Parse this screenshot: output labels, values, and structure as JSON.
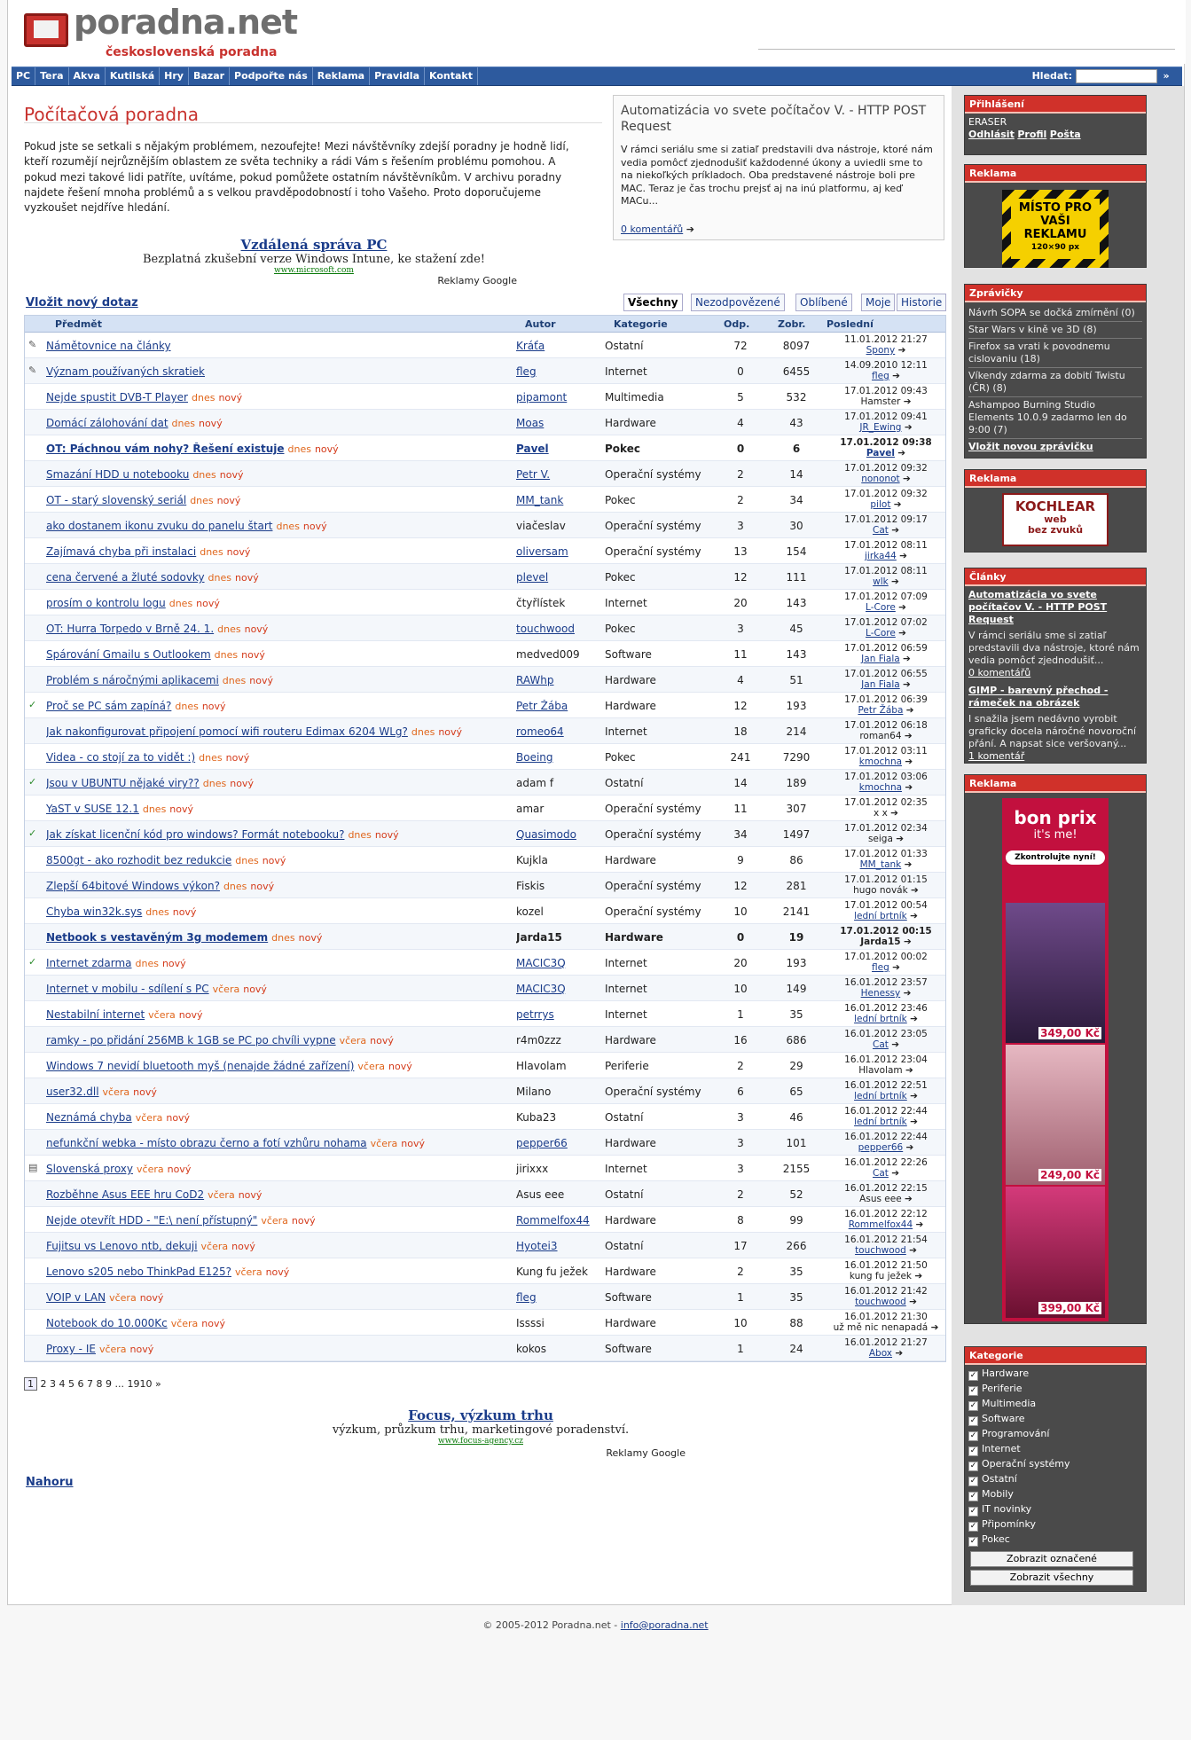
{
  "site": {
    "name": "poradna.net",
    "tagline": "československá poradna"
  },
  "nav": [
    "PC",
    "Tera",
    "Akva",
    "Kutilská",
    "Hry",
    "Bazar",
    "Podpořte nás",
    "Reklama",
    "Pravidla",
    "Kontakt"
  ],
  "search": {
    "label": "Hledat:",
    "go": "»"
  },
  "intro": {
    "title": "Počítačová poradna",
    "text": "Pokud jste se setkali s nějakým problémem, nezoufejte! Mezi návštěvníky zdejší poradny je hodně lidí, kteří rozumějí nejrůznějším oblastem ze světa techniky a rádi Vám s řešením problému pomohou. A pokud mezi takové lidi patříte, uvítáme, pokud pomůžete ostatním návštěvníkům. V archivu poradny najdete řešení mnoha problémů a s velkou pravděpodobností i toho Vašeho. Proto doporučujeme vyzkoušet nejdříve hledání."
  },
  "article": {
    "title": "Automatizácia vo svete počítačov V. - HTTP POST Request",
    "text": "V rámci seriálu sme si zatiaľ predstavili dva nástroje, ktoré nám vedia pomôcť zjednodušiť každodenné úkony a uviedli sme to na niekoľkých príkladoch. Oba predstavené nástroje boli pre MAC. Teraz je čas trochu prejsť aj na inú platformu, aj keď MACu...",
    "comments": "0 komentářů"
  },
  "ad1": {
    "title": "Vzdálená správa PC",
    "desc": "Bezplatná zkušební verze Windows Intune, ke stažení zde!",
    "url": "www.microsoft.com",
    "by": "Reklamy Google"
  },
  "ad2": {
    "title": "Focus, výzkum trhu",
    "desc": "výzkum, průzkum trhu, marketingové poradenství.",
    "url": "www.focus-agency.cz",
    "by": "Reklamy Google"
  },
  "question_bar": {
    "new": "Vložit nový dotaz",
    "tabs": [
      "Všechny",
      "Nezodpovězené",
      "Oblíbené",
      "Moje",
      "Historie"
    ]
  },
  "table_header": {
    "subject": "Předmět",
    "author": "Autor",
    "category": "Kategorie",
    "replies": "Odp.",
    "views": "Zobr.",
    "last": "Poslední"
  },
  "labels": {
    "today": "dnes",
    "yesterday": "včera",
    "new": "nový"
  },
  "rows": [
    {
      "icon": "pin",
      "s": "Námětovnice na články",
      "a": "Kráťa",
      "al": 1,
      "k": "Ostatní",
      "o": "72",
      "z": "8097",
      "d1": "11.01.2012 21:27",
      "d2": "Spony",
      "l": 1
    },
    {
      "icon": "pin",
      "s": "Význam používaných skratiek",
      "a": "fleg",
      "al": 1,
      "k": "Internet",
      "o": "0",
      "z": "6455",
      "d1": "14.09.2010 12:11",
      "d2": "fleg",
      "l": 1
    },
    {
      "s": "Nejde spustit DVB-T Player",
      "tag": "dnes",
      "a": "pipamont",
      "al": 1,
      "k": "Multimedia",
      "o": "5",
      "z": "532",
      "d1": "17.01.2012 09:43",
      "d2": "Hamster"
    },
    {
      "s": "Domácí zálohování dat",
      "tag": "dnes",
      "a": "Moas",
      "al": 1,
      "k": "Hardware",
      "o": "4",
      "z": "43",
      "d1": "17.01.2012 09:41",
      "d2": "JR_Ewing",
      "l": 1
    },
    {
      "s": "OT: Páchnou vám nohy? Řešení existuje",
      "tag": "dnes",
      "a": "Pavel",
      "al": 1,
      "k": "Pokec",
      "o": "0",
      "z": "6",
      "d1": "17.01.2012 09:38",
      "d2": "Pavel",
      "l": 1,
      "bold": 1
    },
    {
      "s": "Smazání HDD u notebooku",
      "tag": "dnes",
      "a": "Petr V.",
      "al": 1,
      "k": "Operační systémy",
      "o": "2",
      "z": "14",
      "d1": "17.01.2012 09:32",
      "d2": "nononot",
      "l": 1
    },
    {
      "s": "OT - starý slovenský seriál",
      "tag": "dnes",
      "a": "MM_tank",
      "al": 1,
      "k": "Pokec",
      "o": "2",
      "z": "34",
      "d1": "17.01.2012 09:32",
      "d2": "pilot",
      "l": 1
    },
    {
      "s": "ako dostanem ikonu zvuku do panelu štart",
      "tag": "dnes",
      "a": "viačeslav",
      "k": "Operační systémy",
      "o": "3",
      "z": "30",
      "d1": "17.01.2012 09:17",
      "d2": "Cat",
      "l": 1
    },
    {
      "s": "Zajímavá chyba při instalaci",
      "tag": "dnes",
      "a": "oliversam",
      "al": 1,
      "k": "Operační systémy",
      "o": "13",
      "z": "154",
      "d1": "17.01.2012 08:11",
      "d2": "jirka44",
      "l": 1
    },
    {
      "s": "cena červené a žluté sodovky",
      "tag": "dnes",
      "a": "plevel",
      "al": 1,
      "k": "Pokec",
      "o": "12",
      "z": "111",
      "d1": "17.01.2012 08:11",
      "d2": "wlk",
      "l": 1
    },
    {
      "s": "prosím o kontrolu logu",
      "tag": "dnes",
      "a": "čtyřlístek",
      "k": "Internet",
      "o": "20",
      "z": "143",
      "d1": "17.01.2012 07:09",
      "d2": "L-Core",
      "l": 1
    },
    {
      "s": "OT: Hurra Torpedo v Brně 24. 1.",
      "tag": "dnes",
      "a": "touchwood",
      "al": 1,
      "k": "Pokec",
      "o": "3",
      "z": "45",
      "d1": "17.01.2012 07:02",
      "d2": "L-Core",
      "l": 1
    },
    {
      "s": "Spárování Gmailu s Outlookem",
      "tag": "dnes",
      "a": "medved009",
      "k": "Software",
      "o": "11",
      "z": "143",
      "d1": "17.01.2012 06:59",
      "d2": "Jan Fiala",
      "l": 1
    },
    {
      "s": "Problém s náročnými aplikacemi",
      "tag": "dnes",
      "a": "RAWhp",
      "al": 1,
      "k": "Hardware",
      "o": "4",
      "z": "51",
      "d1": "17.01.2012 06:55",
      "d2": "Jan Fiala",
      "l": 1
    },
    {
      "icon": "check",
      "s": "Proč se PC sám zapíná?",
      "tag": "dnes",
      "a": "Petr Žába",
      "al": 1,
      "k": "Hardware",
      "o": "12",
      "z": "193",
      "d1": "17.01.2012 06:39",
      "d2": "Petr Žába",
      "l": 1
    },
    {
      "s": "Jak nakonfigurovat připojení pomocí wifi routeru Edimax 6204 WLg?",
      "tag": "dnes",
      "a": "romeo64",
      "al": 1,
      "k": "Internet",
      "o": "18",
      "z": "214",
      "d1": "17.01.2012 06:18",
      "d2": "roman64"
    },
    {
      "s": "Videa - co stojí za to vidět :)",
      "tag": "dnes",
      "a": "Boeing",
      "al": 1,
      "k": "Pokec",
      "o": "241",
      "z": "7290",
      "d1": "17.01.2012 03:11",
      "d2": "kmochna",
      "l": 1
    },
    {
      "icon": "check",
      "s": "Jsou v UBUNTU nějaké viry??",
      "tag": "dnes",
      "a": "adam f",
      "k": "Ostatní",
      "o": "14",
      "z": "189",
      "d1": "17.01.2012 03:06",
      "d2": "kmochna",
      "l": 1
    },
    {
      "s": "YaST v SUSE 12.1",
      "tag": "dnes",
      "a": "amar",
      "k": "Operační systémy",
      "o": "11",
      "z": "307",
      "d1": "17.01.2012 02:35",
      "d2": "x x"
    },
    {
      "icon": "check",
      "s": "Jak získat licenční kód pro windows? Formát notebooku?",
      "tag": "dnes",
      "a": "Quasimodo",
      "al": 1,
      "k": "Operační systémy",
      "o": "34",
      "z": "1497",
      "d1": "17.01.2012 02:34",
      "d2": "seiga"
    },
    {
      "s": "8500gt - ako rozhodit bez redukcie",
      "tag": "dnes",
      "a": "Kujkla",
      "k": "Hardware",
      "o": "9",
      "z": "86",
      "d1": "17.01.2012 01:33",
      "d2": "MM_tank",
      "l": 1
    },
    {
      "s": "Zlepší 64bitové Windows výkon?",
      "tag": "dnes",
      "a": "Fiskis",
      "k": "Operační systémy",
      "o": "12",
      "z": "281",
      "d1": "17.01.2012 01:15",
      "d2": "hugo novák"
    },
    {
      "s": "Chyba win32k.sys",
      "tag": "dnes",
      "a": "kozel",
      "k": "Operační systémy",
      "o": "10",
      "z": "2141",
      "d1": "17.01.2012 00:54",
      "d2": "lední brtník",
      "l": 1
    },
    {
      "s": "Netbook s vestavěným 3g modemem",
      "tag": "dnes",
      "a": "Jarda15",
      "k": "Hardware",
      "o": "0",
      "z": "19",
      "d1": "17.01.2012 00:15",
      "d2": "Jarda15",
      "bold": 1
    },
    {
      "icon": "check",
      "s": "Internet zdarma",
      "tag": "dnes",
      "a": "MACIC3Q",
      "al": 1,
      "k": "Internet",
      "o": "20",
      "z": "193",
      "d1": "17.01.2012 00:02",
      "d2": "fleg",
      "l": 1
    },
    {
      "s": "Internet v mobilu - sdílení s PC",
      "tag": "včera",
      "a": "MACIC3Q",
      "al": 1,
      "k": "Internet",
      "o": "10",
      "z": "149",
      "d1": "16.01.2012 23:57",
      "d2": "Henessy",
      "l": 1
    },
    {
      "s": "Nestabilní internet",
      "tag": "včera",
      "a": "petrrys",
      "al": 1,
      "k": "Internet",
      "o": "1",
      "z": "35",
      "d1": "16.01.2012 23:46",
      "d2": "lední brtník",
      "l": 1
    },
    {
      "s": "ramky - po přidání 256MB k 1GB se PC po chvíli vypne",
      "tag": "včera",
      "a": "r4m0zzz",
      "k": "Hardware",
      "o": "16",
      "z": "686",
      "d1": "16.01.2012 23:05",
      "d2": "Cat",
      "l": 1
    },
    {
      "s": "Windows 7 nevidí bluetooth myš (nenajde žádné zařízení)",
      "tag": "včera",
      "a": "Hlavolam",
      "k": "Periferie",
      "o": "2",
      "z": "29",
      "d1": "16.01.2012 23:04",
      "d2": "Hlavolam"
    },
    {
      "s": "user32.dll",
      "tag": "včera",
      "a": "Milano",
      "k": "Operační systémy",
      "o": "6",
      "z": "65",
      "d1": "16.01.2012 22:51",
      "d2": "lední brtník",
      "l": 1
    },
    {
      "s": "Neznámá chyba",
      "tag": "včera",
      "a": "Kuba23",
      "k": "Ostatní",
      "o": "3",
      "z": "46",
      "d1": "16.01.2012 22:44",
      "d2": "lední brtník",
      "l": 1
    },
    {
      "s": "nefunkční webka - místo obrazu černo a fotí vzhůru nohama",
      "tag": "včera",
      "a": "pepper66",
      "al": 1,
      "k": "Hardware",
      "o": "3",
      "z": "101",
      "d1": "16.01.2012 22:44",
      "d2": "pepper66",
      "l": 1
    },
    {
      "icon": "lock",
      "s": "Slovenská proxy",
      "tag": "včera",
      "a": "jirixxx",
      "k": "Internet",
      "o": "3",
      "z": "2155",
      "d1": "16.01.2012 22:26",
      "d2": "Cat",
      "l": 1
    },
    {
      "s": "Rozběhne Asus EEE hru CoD2",
      "tag": "včera",
      "a": "Asus eee",
      "k": "Ostatní",
      "o": "2",
      "z": "52",
      "d1": "16.01.2012 22:15",
      "d2": "Asus eee"
    },
    {
      "s": "Nejde otevřít HDD - \"E:\\ není přístupný\"",
      "tag": "včera",
      "a": "Rommelfox44",
      "al": 1,
      "k": "Hardware",
      "o": "8",
      "z": "99",
      "d1": "16.01.2012 22:12",
      "d2": "Rommelfox44",
      "l": 1
    },
    {
      "s": "Fujitsu vs Lenovo ntb, dekuji",
      "tag": "včera",
      "a": "Hyotei3",
      "al": 1,
      "k": "Ostatní",
      "o": "17",
      "z": "266",
      "d1": "16.01.2012 21:54",
      "d2": "touchwood",
      "l": 1
    },
    {
      "s": "Lenovo s205 nebo ThinkPad E125?",
      "tag": "včera",
      "a": "Kung fu ježek",
      "k": "Hardware",
      "o": "2",
      "z": "35",
      "d1": "16.01.2012 21:50",
      "d2": "kung fu ježek"
    },
    {
      "s": "VOIP v LAN",
      "tag": "včera",
      "a": "fleg",
      "al": 1,
      "k": "Software",
      "o": "1",
      "z": "35",
      "d1": "16.01.2012 21:42",
      "d2": "touchwood",
      "l": 1
    },
    {
      "s": "Notebook do 10.000Kc",
      "tag": "včera",
      "a": "Issssi",
      "k": "Hardware",
      "o": "10",
      "z": "88",
      "d1": "16.01.2012 21:30",
      "d2": "už mě nic nenapadá"
    },
    {
      "s": "Proxy - IE",
      "tag": "včera",
      "a": "kokos",
      "k": "Software",
      "o": "1",
      "z": "24",
      "d1": "16.01.2012 21:27",
      "d2": "Abox",
      "l": 1
    }
  ],
  "pager": {
    "current": "1",
    "pages": [
      "2",
      "3",
      "4",
      "5",
      "6",
      "7",
      "8",
      "9",
      "...",
      "1910",
      "»"
    ]
  },
  "top_link": "Nahoru",
  "login": {
    "title": "Přihlášení",
    "user": "ERASER",
    "links": [
      "Odhlásit",
      "Profil",
      "Pošta"
    ]
  },
  "ads_title": "Reklama",
  "ad_box": {
    "line1": "MÍSTO PRO",
    "line2": "VAŠI",
    "line3": "REKLAMU",
    "line4": "120×90 px"
  },
  "kochlear": {
    "name": "KOCHLEAR",
    "line1": "web",
    "line2": "bez zvuků"
  },
  "news": {
    "title": "Zprávičky",
    "items": [
      "Návrh SOPA se dočká zmírnění (0)",
      "Star Wars v kině ve 3D (8)",
      "Firefox sa vrati k povodnemu cislovaniu (18)",
      "Víkendy zdarma za dobití Twistu (ČR) (8)",
      "Ashampoo Burning Studio Elements 10.0.9 zadarmo len do 9:00 (7)"
    ],
    "add": "Vložit novou zprávičku"
  },
  "articles": {
    "title": "Články",
    "items": [
      {
        "title": "Automatizácia vo svete počítačov V. - HTTP POST Request",
        "text": "V rámci seriálu sme si zatiaľ predstavili dva nástroje, ktoré nám vedia pomôcť zjednodušiť...",
        "c": "0 komentářů"
      },
      {
        "title": "GIMP - barevný přechod - rámeček na obrázek",
        "text": "I snažila jsem nedávno vyrobit graficky docela náročné novoroční přání. A napsat sice veršovaný...",
        "c": "1 komentář"
      }
    ]
  },
  "bonprix": {
    "brand": "bon prix",
    "slogan": "it's me!",
    "cta": "Zkontrolujte nyní!",
    "prices": [
      "349,00 Kč",
      "249,00 Kč",
      "399,00 Kč"
    ]
  },
  "categories": {
    "title": "Kategorie",
    "items": [
      "Hardware",
      "Periferie",
      "Multimedia",
      "Software",
      "Programování",
      "Internet",
      "Operační systémy",
      "Ostatní",
      "Mobily",
      "IT novinky",
      "Připomínky",
      "Pokec"
    ],
    "btn1": "Zobrazit označené",
    "btn2": "Zobrazit všechny"
  },
  "footer": {
    "copy": "© 2005-2012 Poradna.net - ",
    "mail": "info@poradna.net"
  },
  "colors": {
    "accent": "#c8322e",
    "nav": "#2d5a9e",
    "link": "#1a3c8a",
    "new": "#d43a1a"
  }
}
